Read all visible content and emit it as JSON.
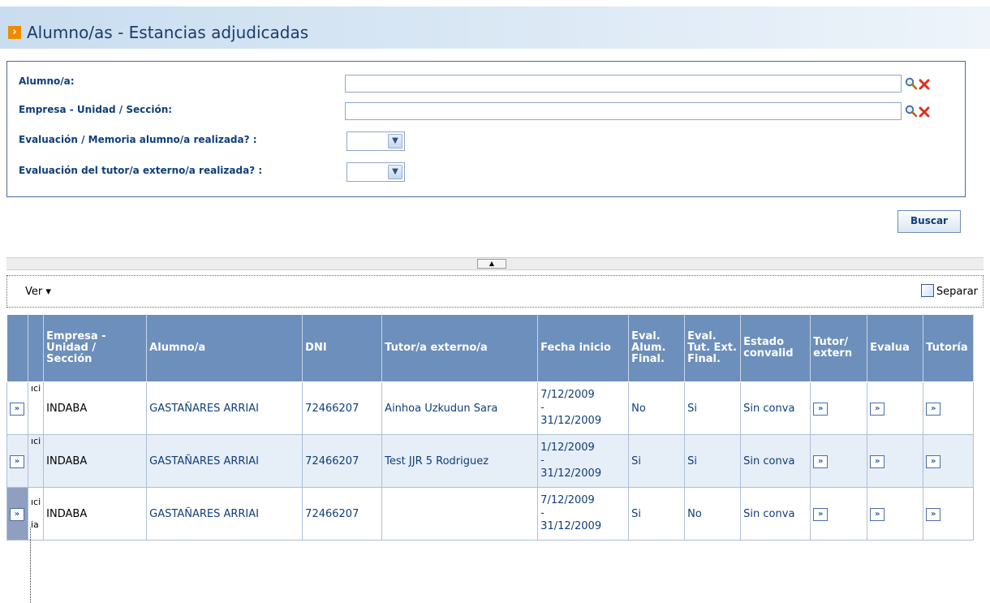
{
  "page": {
    "title": "Alumno/as - Estancias adjudicadas",
    "title_icon": "orange-arrow-icon"
  },
  "filters": {
    "alumno_label": "Alumno/a:",
    "alumno_value": "",
    "empresa_label": "Empresa - Unidad / Sección:",
    "empresa_value": "",
    "eval_memoria_label": "Evaluación / Memoria alumno/a realizada? :",
    "eval_memoria_value": "",
    "eval_tutor_label": "Evaluación del tutor/a externo/a realizada? :",
    "eval_tutor_value": "",
    "search_icon": "magnifier-icon",
    "clear_icon": "red-x-icon",
    "buscar_label": "Buscar"
  },
  "toolbar": {
    "ver_label": "Ver ▾",
    "separar_label": "Separar"
  },
  "grid": {
    "columns": [
      "",
      "",
      "Empresa - Unidad / Sección",
      "Alumno/a",
      "DNI",
      "Tutor/a externo/a",
      "Fecha inicio",
      "Eval. Alum. Final.",
      "Eval. Tut. Ext. Final.",
      "Estado convalid",
      "Tutor/ extern",
      "Evalua",
      "Tutoría"
    ],
    "rows": [
      {
        "frag": "ıci",
        "empresa": "INDABA",
        "alumno": "GASTAÑARES ARRIAI",
        "dni": "72466207",
        "tutor": "Ainhoa Uzkudun Sara",
        "fecha_ini": "7/12/2009",
        "fecha_sep": "-",
        "fecha_fin": "31/12/2009",
        "eval_alum": "No",
        "eval_tut": "Si",
        "estado": "Sin conva"
      },
      {
        "frag": "ıci",
        "empresa": "INDABA",
        "alumno": "GASTAÑARES ARRIAI",
        "dni": "72466207",
        "tutor": "Test JJR 5 Rodriguez",
        "fecha_ini": "1/12/2009",
        "fecha_sep": "-",
        "fecha_fin": "31/12/2009",
        "eval_alum": "Si",
        "eval_tut": "Si",
        "estado": "Sin conva"
      },
      {
        "frag": "ıci",
        "frag2": "ia",
        "empresa": "INDABA",
        "alumno": "GASTAÑARES ARRIAI",
        "dni": "72466207",
        "tutor": "",
        "fecha_ini": "7/12/2009",
        "fecha_sep": "-",
        "fecha_fin": "31/12/2009",
        "eval_alum": "Si",
        "eval_tut": "No",
        "estado": "Sin conva"
      }
    ],
    "action_label": "»",
    "action_icon": "go-arrow-icon"
  },
  "splitter": {
    "handle_label": "▲"
  }
}
